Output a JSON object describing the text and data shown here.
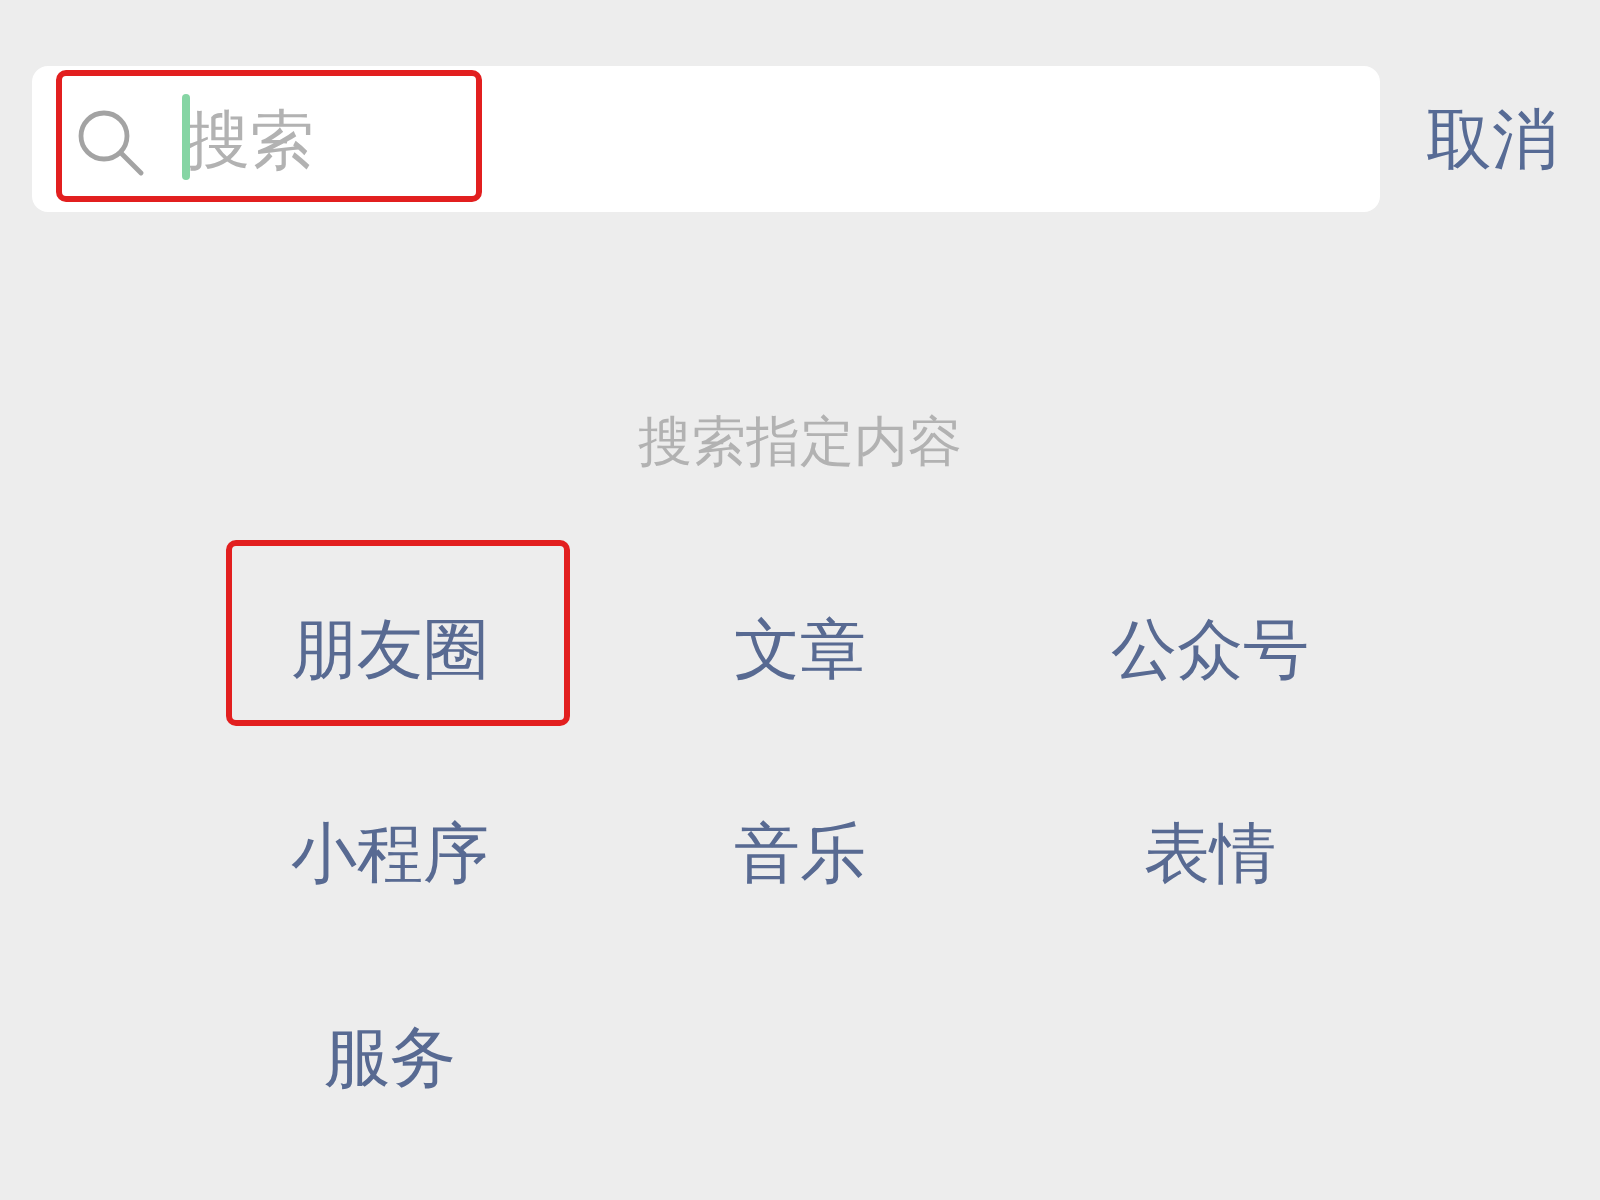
{
  "search": {
    "placeholder": "搜索",
    "focused": true,
    "highlighted": true
  },
  "cancel_button": "取消",
  "section_title": "搜索指定内容",
  "categories": [
    {
      "label": "朋友圈",
      "highlighted": true
    },
    {
      "label": "文章",
      "highlighted": false
    },
    {
      "label": "公众号",
      "highlighted": false
    },
    {
      "label": "小程序",
      "highlighted": false
    },
    {
      "label": "音乐",
      "highlighted": false
    },
    {
      "label": "表情",
      "highlighted": false
    },
    {
      "label": "服务",
      "highlighted": false
    }
  ]
}
